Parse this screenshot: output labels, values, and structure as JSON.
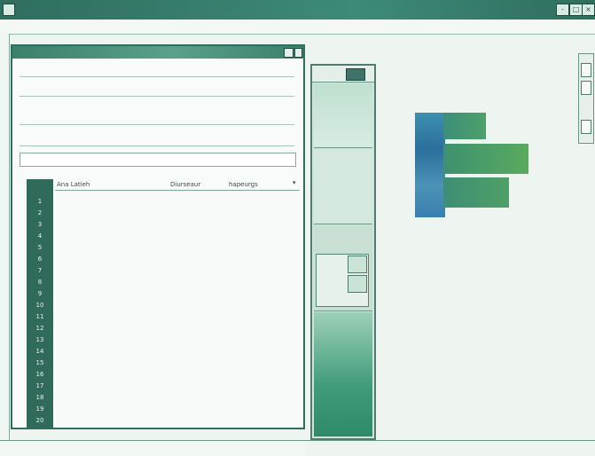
{
  "window": {
    "title": "",
    "controls": [
      "-",
      "□",
      "×"
    ]
  },
  "menu": {
    "items": [
      "",
      "",
      "",
      "",
      "",
      "",
      "",
      ""
    ]
  },
  "dialog": {
    "title": "",
    "fields": [
      "",
      "",
      "",
      "",
      ""
    ],
    "input_hint": "",
    "list_columns": [
      "Ana Latieh",
      "Diurseaur",
      "hapeurgs"
    ],
    "row_numbers": [
      "1",
      "2",
      "3",
      "4",
      "5",
      "6",
      "7",
      "8",
      "9",
      "10",
      "11",
      "12",
      "13",
      "14",
      "15",
      "16",
      "17",
      "18",
      "19",
      "20"
    ]
  },
  "status": {
    "left_items": [
      "",
      "",
      ""
    ],
    "right_items": [
      "",
      "",
      "",
      "",
      ""
    ]
  },
  "colors": {
    "title_bar": "#2f6e5e",
    "accent_blue": "#2b6f9c",
    "accent_green": "#4ea06a"
  }
}
